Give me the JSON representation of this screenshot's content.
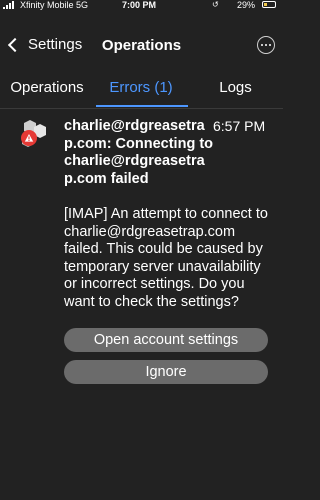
{
  "status_bar": {
    "carrier": "Xfinity Mobile  5G",
    "time": "7:00 PM",
    "battery": "29%",
    "battery_level": 0.29
  },
  "nav": {
    "back_label": "Settings",
    "title": "Operations"
  },
  "tabs": [
    {
      "label": "Operations"
    },
    {
      "label": "Errors (1)",
      "active": true
    },
    {
      "label": "Logs"
    }
  ],
  "error": {
    "heading": "charlie@rdgreasetrap.com: Connecting to charlie@rdgreasetrap.com failed",
    "time": "6:57 PM",
    "message": "[IMAP] An attempt to connect to charlie@rdgreasetrap.com failed. This could be caused by temporary server unavailability or incorrect settings. Do you want to check the settings?"
  },
  "buttons": {
    "open_settings": "Open account settings",
    "ignore": "Ignore"
  },
  "colors": {
    "accent": "#4d97ff",
    "error": "#e53935",
    "background": "#222222"
  }
}
